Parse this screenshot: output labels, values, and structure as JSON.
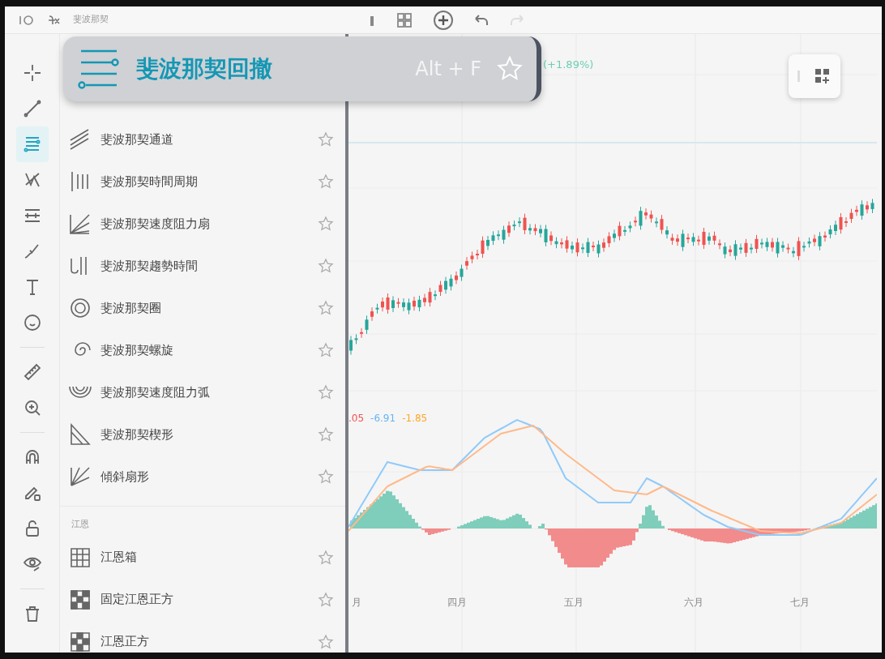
{
  "topbar": {
    "panel_title": "斐波那契"
  },
  "chart_toolbar": {
    "undo": {
      "disabled": false
    },
    "redo": {
      "disabled": true
    }
  },
  "tools": [
    {
      "selected": false
    },
    {
      "selected": false
    },
    {
      "selected": true
    },
    {
      "selected": false
    },
    {
      "selected": false
    },
    {
      "selected": false
    },
    {
      "selected": false
    },
    {
      "selected": false
    },
    {
      "selected": false
    },
    {
      "selected": false
    },
    {
      "selected": false
    },
    {
      "selected": false
    },
    {
      "selected": false
    },
    {
      "selected": false
    },
    {
      "selected": false
    }
  ],
  "flyout": {
    "sections": [
      {
        "items": [
          {
            "label": "斐波那契通道",
            "favorite": false
          },
          {
            "label": "斐波那契時間周期",
            "favorite": false
          },
          {
            "label": "斐波那契速度阻力扇",
            "favorite": false
          },
          {
            "label": "斐波那契趨勢時間",
            "favorite": false
          },
          {
            "label": "斐波那契圈",
            "favorite": false
          },
          {
            "label": "斐波那契螺旋",
            "favorite": false
          },
          {
            "label": "斐波那契速度阻力弧",
            "favorite": false
          },
          {
            "label": "斐波那契楔形",
            "favorite": false
          },
          {
            "label": "傾斜扇形",
            "favorite": false
          }
        ]
      },
      {
        "heading": "江恩",
        "items": [
          {
            "label": "江恩箱",
            "favorite": false
          },
          {
            "label": "固定江恩正方",
            "favorite": false
          },
          {
            "label": "江恩正方",
            "favorite": false
          }
        ]
      }
    ]
  },
  "tooltip": {
    "title": "斐波那契回撤",
    "shortcut": "Alt + F",
    "favorite": false
  },
  "chart": {
    "change": "(+1.89%)",
    "macd_values": [
      {
        "text": ".05",
        "color": "#ef5350"
      },
      {
        "text": "-6.91",
        "color": "#64b5f6"
      },
      {
        "text": "-1.85",
        "color": "#ffa726"
      }
    ],
    "months": [
      "月",
      "四月",
      "五月",
      "六月",
      "七月"
    ]
  }
}
